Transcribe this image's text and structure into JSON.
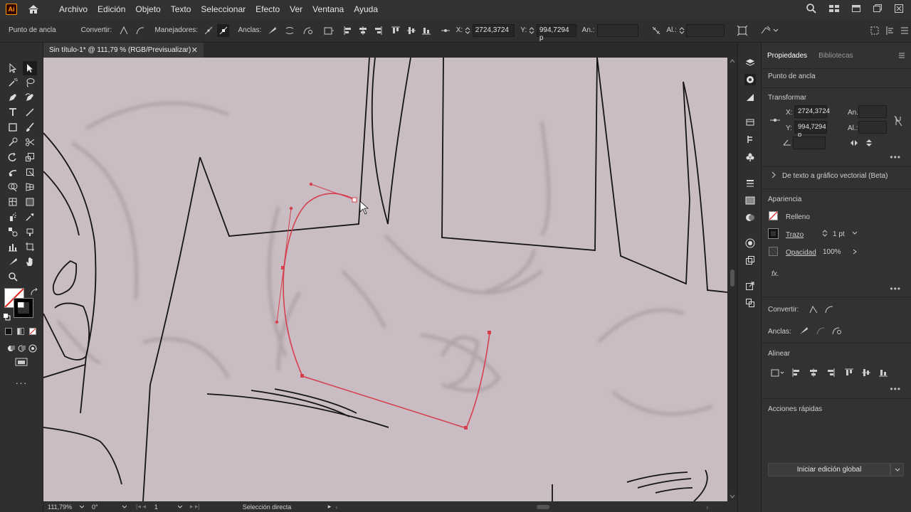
{
  "app": {
    "logo_text": "Ai",
    "menu": [
      "Archivo",
      "Edición",
      "Objeto",
      "Texto",
      "Seleccionar",
      "Efecto",
      "Ver",
      "Ventana",
      "Ayuda"
    ]
  },
  "control_bar": {
    "selection_label": "Punto de ancla",
    "convert_label": "Convertir:",
    "handles_label": "Manejadores:",
    "anchors_label": "Anclas:",
    "x_label": "X:",
    "x_value": "2724,3724",
    "y_label": "Y:",
    "y_value": "994,7294 p",
    "width_label": "An.:",
    "height_label": "Al.:"
  },
  "document": {
    "tab_title": "Sin título-1* @ 111,79 % (RGB/Previsualizar)"
  },
  "status_bar": {
    "zoom": "111,79%",
    "rotation": "0°",
    "artboard": "1",
    "tool": "Selección directa"
  },
  "properties": {
    "tab_active": "Propiedades",
    "tab_inactive": "Bibliotecas",
    "selection": "Punto de ancla",
    "transform_title": "Transformar",
    "x_label": "X:",
    "x_value": "2724,3724",
    "y_label": "Y:",
    "y_value": "994,7294 p",
    "w_label": "An.:",
    "h_label": "Al.:",
    "vector_text": "De texto a gráfico vectorial (Beta)",
    "appearance_title": "Apariencia",
    "fill_label": "Relleno",
    "stroke_label": "Trazo",
    "stroke_value": "1 pt",
    "opacity_label": "Opacidad",
    "opacity_value": "100%",
    "fx_label": "fx.",
    "convert_label": "Convertir:",
    "anchors_label": "Anclas:",
    "align_title": "Alinear",
    "quick_actions_title": "Acciones rápidas",
    "global_edit_button": "Iniciar edición global"
  },
  "colors": {
    "canvas_bg": "#c9bcc2",
    "path_selected": "#d6404e",
    "ui_dark": "#2f2f2f",
    "brand": "#ff9a00"
  }
}
